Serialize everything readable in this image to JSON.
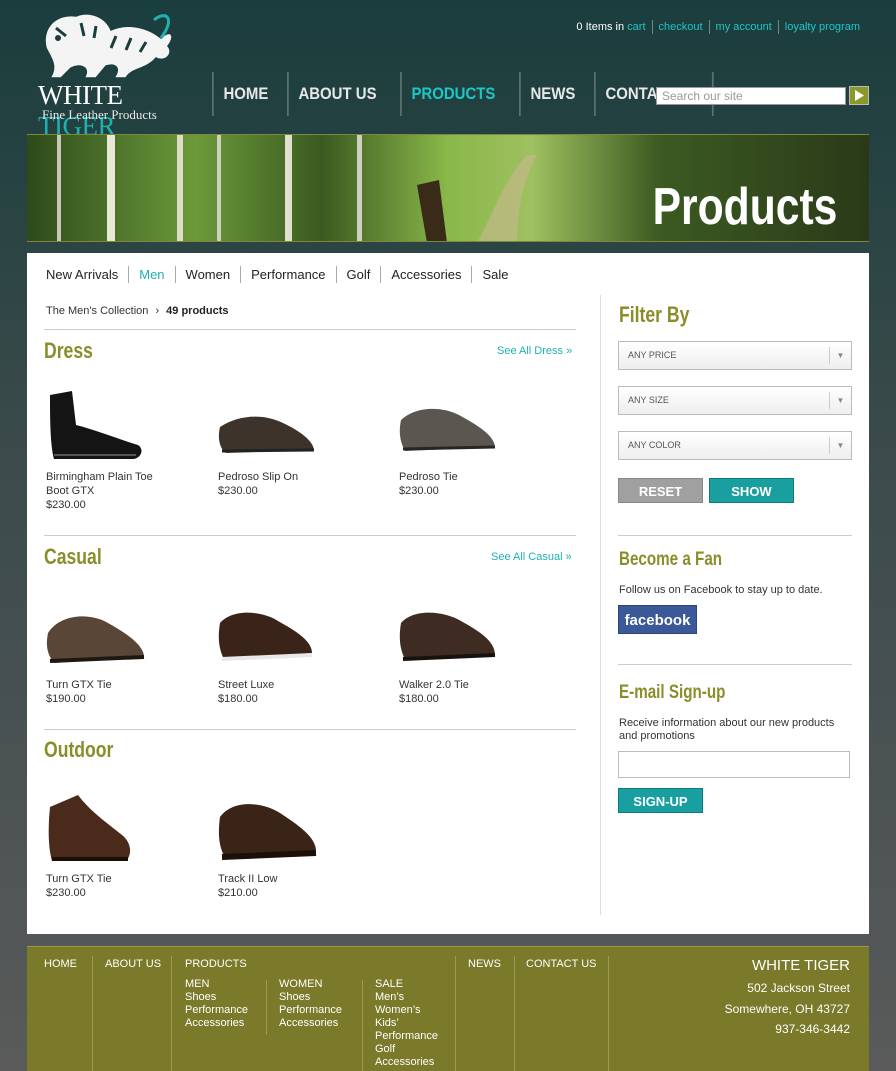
{
  "brand": {
    "name_part1": "WHITE ",
    "name_part2": "TIGER",
    "tagline": "Fine Leather Products"
  },
  "toplinks": {
    "items_prefix": "0 Items in ",
    "cart": "cart",
    "checkout": "checkout",
    "account": "my account",
    "loyalty": "loyalty program"
  },
  "nav": [
    "HOME",
    "ABOUT US",
    "PRODUCTS",
    "NEWS",
    "CONTACT US"
  ],
  "nav_active": "PRODUCTS",
  "search": {
    "placeholder": "Search our site"
  },
  "banner": {
    "title": "Products"
  },
  "subnav": [
    "New Arrivals",
    "Men",
    "Women",
    "Performance",
    "Golf",
    "Accessories",
    "Sale"
  ],
  "subnav_active": "Men",
  "breadcrumb": {
    "collection": "The Men's Collection",
    "sep": "›",
    "count": "49 products"
  },
  "sections": [
    {
      "title": "Dress",
      "see_all": "See All Dress »",
      "products": [
        {
          "name": "Birmingham Plain Toe Boot GTX",
          "price": "$230.00"
        },
        {
          "name": "Pedroso Slip On",
          "price": "$230.00"
        },
        {
          "name": "Pedroso Tie",
          "price": "$230.00"
        }
      ]
    },
    {
      "title": "Casual",
      "see_all": "See All Casual »",
      "products": [
        {
          "name": "Turn GTX Tie",
          "price": "$190.00"
        },
        {
          "name": "Street Luxe",
          "price": "$180.00"
        },
        {
          "name": "Walker 2.0 Tie",
          "price": "$180.00"
        }
      ]
    },
    {
      "title": "Outdoor",
      "see_all": "",
      "products": [
        {
          "name": "Turn GTX Tie",
          "price": "$230.00"
        },
        {
          "name": "Track II Low",
          "price": "$210.00"
        }
      ]
    }
  ],
  "filter": {
    "title": "Filter By",
    "price": "ANY PRICE",
    "size": "ANY SIZE",
    "color": "ANY COLOR",
    "reset": "RESET",
    "show": "SHOW"
  },
  "fan": {
    "title": "Become a Fan",
    "text": "Follow us on Facebook to stay up to date.",
    "button": "facebook"
  },
  "signup": {
    "title": "E-mail Sign-up",
    "text": "Receive information about our new products and promotions",
    "button": "SIGN-UP"
  },
  "footer": {
    "home": "HOME",
    "about": "ABOUT US",
    "products": "PRODUCTS",
    "news": "NEWS",
    "contact": "CONTACT US",
    "men": {
      "title": "MEN",
      "items": [
        "Shoes",
        "Performance",
        "Accessories"
      ]
    },
    "women": {
      "title": "WOMEN",
      "items": [
        "Shoes",
        "Performance",
        "Accessories"
      ]
    },
    "sale": {
      "title": "SALE",
      "items": [
        "Men’s",
        "Women’s",
        "Kids’",
        "Performance",
        "Golf",
        "Accessories"
      ]
    },
    "company": "WHITE TIGER",
    "street": "502 Jackson Street",
    "city": "Somewhere, OH 43727",
    "phone": "937-346-3442"
  },
  "colors": {
    "accent": "#1fb0b0",
    "olive": "#8a8e2a",
    "footer": "#7a7a2a",
    "facebook": "#3b5998"
  }
}
